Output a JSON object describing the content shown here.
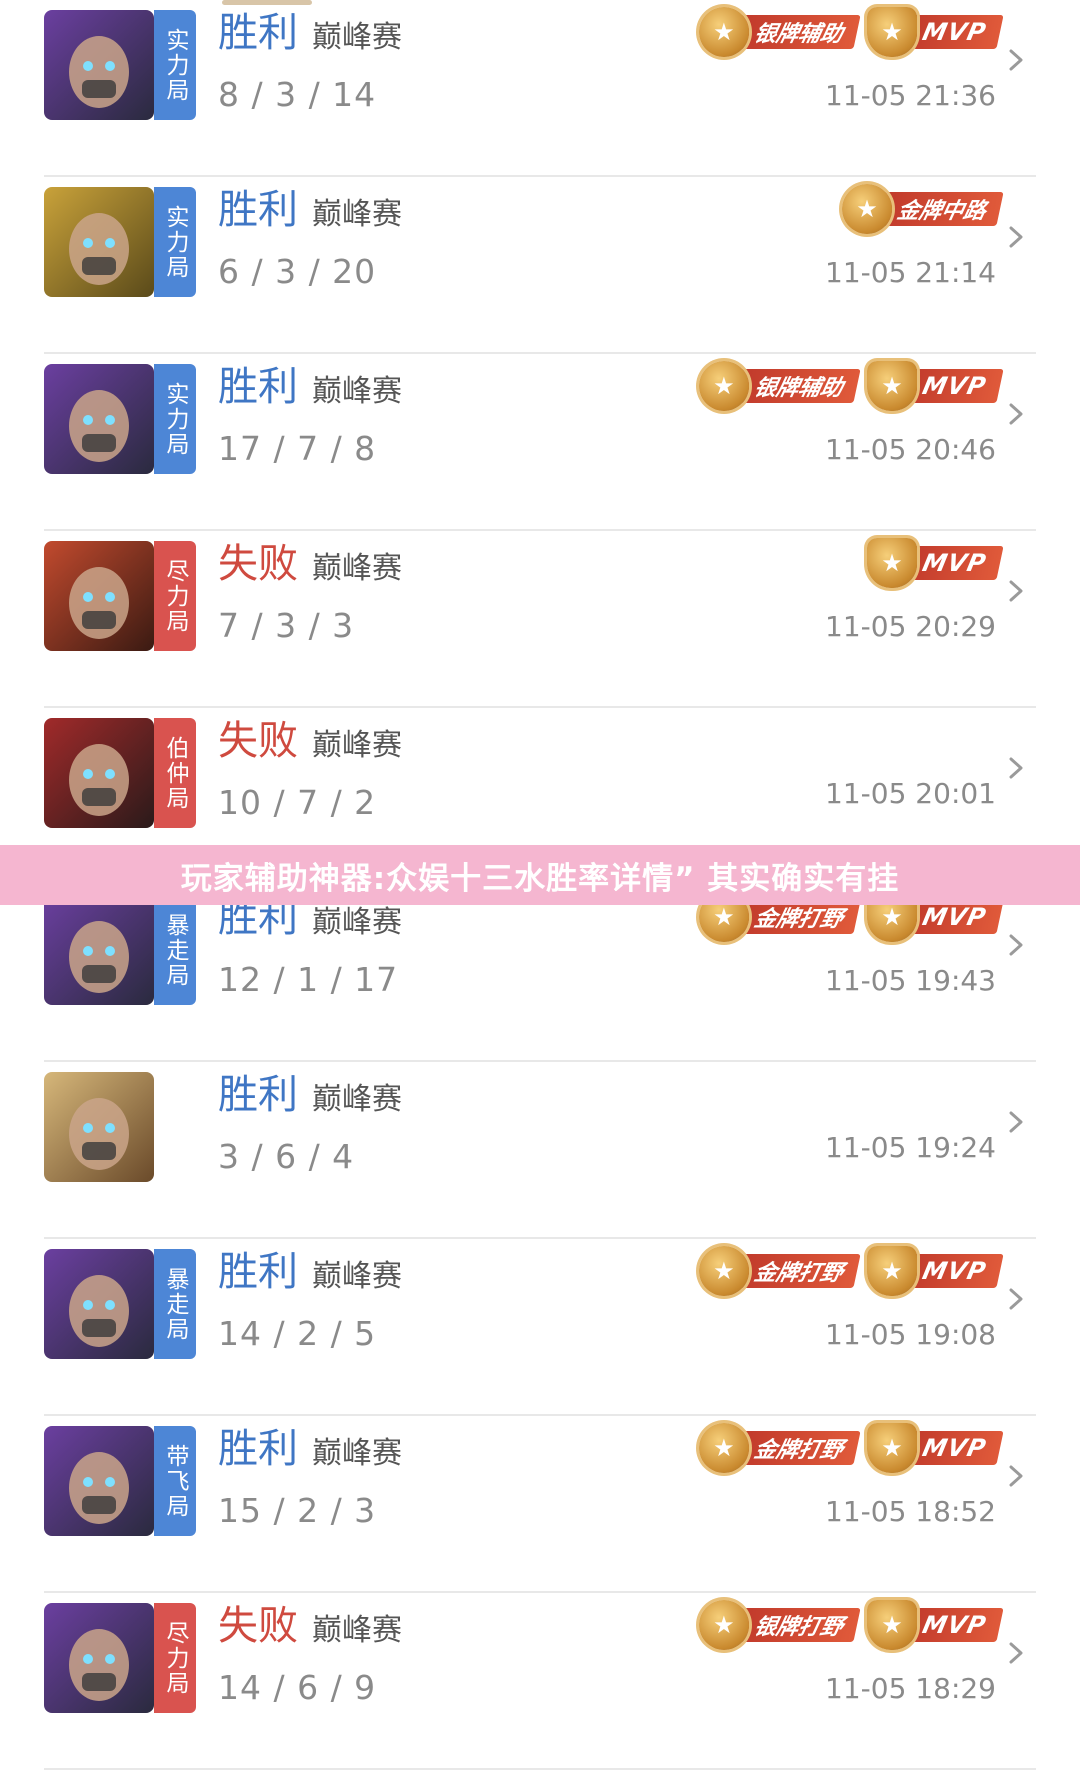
{
  "banner": {
    "text": "玩家辅助神器:众娱十三水胜率详情” 其实确实有挂"
  },
  "rows": [
    {
      "result": "胜利",
      "mode": "巅峰赛",
      "kda": "8 / 3 / 14",
      "time": "11-05 21:36",
      "tag": "实力局",
      "badges": [
        "银牌辅助",
        "MVP"
      ]
    },
    {
      "result": "胜利",
      "mode": "巅峰赛",
      "kda": "6 / 3 / 20",
      "time": "11-05 21:14",
      "tag": "实力局",
      "badges": [
        "金牌中路"
      ]
    },
    {
      "result": "胜利",
      "mode": "巅峰赛",
      "kda": "17 / 7 / 8",
      "time": "11-05 20:46",
      "tag": "实力局",
      "badges": [
        "银牌辅助",
        "MVP"
      ]
    },
    {
      "result": "失败",
      "mode": "巅峰赛",
      "kda": "7 / 3 / 3",
      "time": "11-05 20:29",
      "tag": "尽力局",
      "badges": [
        "MVP"
      ]
    },
    {
      "result": "失败",
      "mode": "巅峰赛",
      "kda": "10 / 7 / 2",
      "time": "11-05 20:01",
      "tag": "伯仲局",
      "badges": []
    },
    {
      "result": "胜利",
      "mode": "巅峰赛",
      "kda": "12 / 1 / 17",
      "time": "11-05 19:43",
      "tag": "暴走局",
      "badges": [
        "金牌打野",
        "MVP"
      ]
    },
    {
      "result": "胜利",
      "mode": "巅峰赛",
      "kda": "3 / 6 / 4",
      "time": "11-05 19:24",
      "tag": "",
      "badges": []
    },
    {
      "result": "胜利",
      "mode": "巅峰赛",
      "kda": "14 / 2 / 5",
      "time": "11-05 19:08",
      "tag": "暴走局",
      "badges": [
        "金牌打野",
        "MVP"
      ]
    },
    {
      "result": "胜利",
      "mode": "巅峰赛",
      "kda": "15 / 2 / 3",
      "time": "11-05 18:52",
      "tag": "带飞局",
      "badges": [
        "金牌打野",
        "MVP"
      ]
    },
    {
      "result": "失败",
      "mode": "巅峰赛",
      "kda": "14 / 6 / 9",
      "time": "11-05 18:29",
      "tag": "尽力局",
      "badges": [
        "银牌打野",
        "MVP"
      ]
    }
  ],
  "colors": {
    "win": "#3f76c4",
    "lose": "#cf4a3f",
    "tag_blue": "#4d86d6",
    "tag_red": "#d9534f",
    "banner": "#f5b6d0"
  }
}
